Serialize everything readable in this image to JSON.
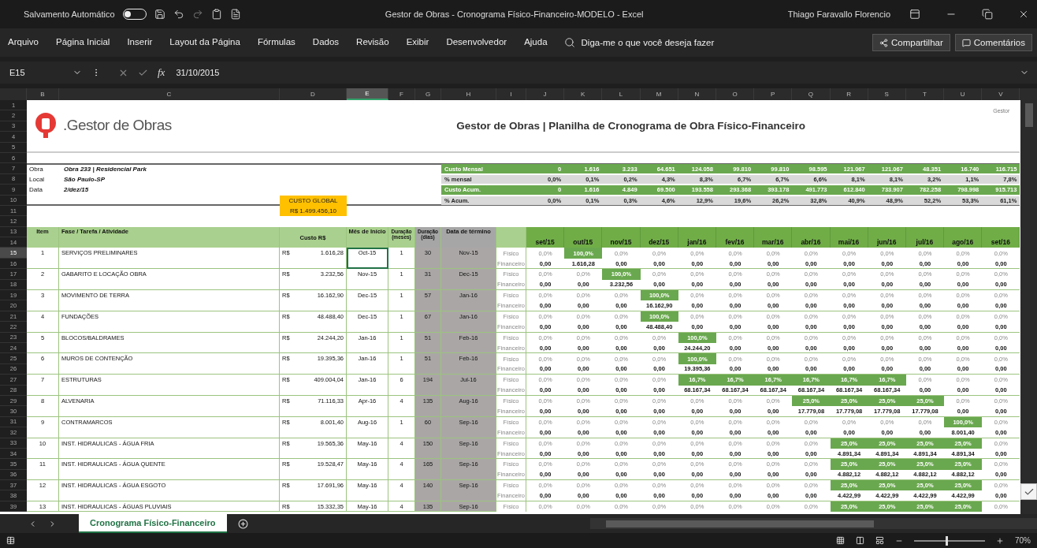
{
  "title_bar": {
    "autosave": {
      "label": "Salvamento Automático",
      "on": false
    },
    "title": "Gestor de Obras - Cronograma Físico-Financeiro-MODELO  -  Excel",
    "user": "Thiago Faravallo Florencio"
  },
  "ribbon": {
    "tabs": [
      {
        "label": "Arquivo",
        "selected": false
      },
      {
        "label": "Página Inicial",
        "selected": false
      },
      {
        "label": "Inserir",
        "selected": false
      },
      {
        "label": "Layout da Página",
        "selected": false
      },
      {
        "label": "Fórmulas",
        "selected": false
      },
      {
        "label": "Dados",
        "selected": false
      },
      {
        "label": "Revisão",
        "selected": false
      },
      {
        "label": "Exibir",
        "selected": false
      },
      {
        "label": "Desenvolvedor",
        "selected": false
      },
      {
        "label": "Ajuda",
        "selected": false
      }
    ],
    "search": {
      "placeholder": "Diga-me o que você deseja fazer"
    },
    "share": "Compartilhar",
    "comments": "Comentários"
  },
  "formula_bar": {
    "name_box": "E15",
    "function_symbol": "fx",
    "value": "31/10/2015"
  },
  "columns": [
    {
      "label": "B",
      "selected": false
    },
    {
      "label": "C",
      "selected": false
    },
    {
      "label": "D",
      "selected": false
    },
    {
      "label": "E",
      "selected": true
    },
    {
      "label": "F",
      "selected": false
    },
    {
      "label": "G",
      "selected": false
    },
    {
      "label": "H",
      "selected": false
    },
    {
      "label": "I",
      "selected": false
    },
    {
      "label": "J",
      "selected": false
    },
    {
      "label": "K",
      "selected": false
    },
    {
      "label": "L",
      "selected": false
    },
    {
      "label": "M",
      "selected": false
    },
    {
      "label": "N",
      "selected": false
    },
    {
      "label": "O",
      "selected": false
    },
    {
      "label": "P",
      "selected": false
    },
    {
      "label": "Q",
      "selected": false
    },
    {
      "label": "R",
      "selected": false
    },
    {
      "label": "S",
      "selected": false
    },
    {
      "label": "T",
      "selected": false
    },
    {
      "label": "U",
      "selected": false
    },
    {
      "label": "V",
      "selected": false
    }
  ],
  "rows": [
    {
      "label": "1",
      "selected": false
    },
    {
      "label": "2",
      "selected": false
    },
    {
      "label": "3",
      "selected": false
    },
    {
      "label": "4",
      "selected": false
    },
    {
      "label": "5",
      "selected": false
    },
    {
      "label": "6",
      "selected": false
    },
    {
      "label": "7",
      "selected": false
    },
    {
      "label": "8",
      "selected": false
    },
    {
      "label": "9",
      "selected": false
    },
    {
      "label": "10",
      "selected": false
    },
    {
      "label": "11",
      "selected": false
    },
    {
      "label": "12",
      "selected": false
    },
    {
      "label": "13",
      "selected": false
    },
    {
      "label": "14",
      "selected": false
    },
    {
      "label": "15",
      "selected": true
    },
    {
      "label": "16",
      "selected": false
    },
    {
      "label": "17",
      "selected": false
    },
    {
      "label": "18",
      "selected": false
    },
    {
      "label": "19",
      "selected": false
    },
    {
      "label": "20",
      "selected": false
    },
    {
      "label": "21",
      "selected": false
    },
    {
      "label": "22",
      "selected": false
    },
    {
      "label": "23",
      "selected": false
    },
    {
      "label": "24",
      "selected": false
    },
    {
      "label": "25",
      "selected": false
    },
    {
      "label": "26",
      "selected": false
    },
    {
      "label": "27",
      "selected": false
    },
    {
      "label": "28",
      "selected": false
    },
    {
      "label": "29",
      "selected": false
    },
    {
      "label": "30",
      "selected": false
    },
    {
      "label": "31",
      "selected": false
    },
    {
      "label": "32",
      "selected": false
    },
    {
      "label": "33",
      "selected": false
    },
    {
      "label": "34",
      "selected": false
    },
    {
      "label": "35",
      "selected": false
    },
    {
      "label": "36",
      "selected": false
    },
    {
      "label": "37",
      "selected": false
    },
    {
      "label": "38",
      "selected": false
    },
    {
      "label": "39",
      "selected": false
    }
  ],
  "sheet": {
    "brand": ".Gestor de Obras",
    "title": "Gestor de Obras | Planilha de Cronograma de Obra Físico-Financeiro",
    "corner_text": "Gestor",
    "info": [
      {
        "label": "Obra",
        "value": "Obra 233 | Residencial Park"
      },
      {
        "label": "Local",
        "value": "São Paulo-SP"
      },
      {
        "label": "Data",
        "value": "2/dez/15"
      }
    ],
    "global_cost": {
      "label": "CUSTO GLOBAL",
      "value": "R$ 1.499.456,10"
    },
    "summary": [
      {
        "label": "Custo Mensal",
        "kind": "cost",
        "values": [
          "0",
          "1.616",
          "3.233",
          "64.651",
          "124.058",
          "99.810",
          "99.810",
          "98.595",
          "121.067",
          "121.067",
          "48.351",
          "16.740",
          "116.715"
        ]
      },
      {
        "label": "% mensal",
        "kind": "percent",
        "values": [
          "0,0%",
          "0,1%",
          "0,2%",
          "4,3%",
          "8,3%",
          "6,7%",
          "6,7%",
          "6,6%",
          "8,1%",
          "8,1%",
          "3,2%",
          "1,1%",
          "7,8%"
        ]
      },
      {
        "label": "Custo Acum.",
        "kind": "cost",
        "values": [
          "0",
          "1.616",
          "4.849",
          "69.500",
          "193.558",
          "293.368",
          "393.178",
          "491.773",
          "612.840",
          "733.907",
          "782.258",
          "798.998",
          "915.713"
        ]
      },
      {
        "label": "% Acum.",
        "kind": "percent",
        "values": [
          "0,0%",
          "0,1%",
          "0,3%",
          "4,6%",
          "12,9%",
          "19,6%",
          "26,2%",
          "32,8%",
          "40,9%",
          "48,9%",
          "52,2%",
          "53,3%",
          "61,1%"
        ]
      }
    ],
    "headers": {
      "item": "Item",
      "task": "Fase / Tarefa / Atividade",
      "cost": "Custo R$",
      "start": "Mês de Início",
      "months": "Duração (meses)",
      "days": "Duração (dias)",
      "end": "Data de término"
    },
    "months": [
      "set/15",
      "out/15",
      "nov/15",
      "dez/15",
      "jan/16",
      "fev/16",
      "mar/16",
      "abr/16",
      "mai/16",
      "jun/16",
      "jul/16",
      "ago/16",
      "set/16"
    ],
    "tasks": [
      {
        "item": "1",
        "name": "SERVIÇOS PRELIMINARES",
        "currency": "R$",
        "cost": "1.616,28",
        "start": "Oct-15",
        "start_selected": true,
        "months": "1",
        "days": "30",
        "end": "Nov-15",
        "physical_label": "Físico",
        "financial_label": "Financeiro",
        "schedule": [
          {
            "pct": "0,0%",
            "value": "0,00",
            "active": false
          },
          {
            "pct": "100,0%",
            "value": "1.616,28",
            "active": true
          },
          {
            "pct": "0,0%",
            "value": "0,00",
            "active": false
          },
          {
            "pct": "0,0%",
            "value": "0,00",
            "active": false
          },
          {
            "pct": "0,0%",
            "value": "0,00",
            "active": false
          },
          {
            "pct": "0,0%",
            "value": "0,00",
            "active": false
          },
          {
            "pct": "0,0%",
            "value": "0,00",
            "active": false
          },
          {
            "pct": "0,0%",
            "value": "0,00",
            "active": false
          },
          {
            "pct": "0,0%",
            "value": "0,00",
            "active": false
          },
          {
            "pct": "0,0%",
            "value": "0,00",
            "active": false
          },
          {
            "pct": "0,0%",
            "value": "0,00",
            "active": false
          },
          {
            "pct": "0,0%",
            "value": "0,00",
            "active": false
          },
          {
            "pct": "0,0%",
            "value": "0,00",
            "active": false
          }
        ]
      },
      {
        "item": "2",
        "name": "GABARITO E LOCAÇÃO OBRA",
        "currency": "R$",
        "cost": "3.232,56",
        "start": "Nov-15",
        "start_selected": false,
        "months": "1",
        "days": "31",
        "end": "Dec-15",
        "physical_label": "Físico",
        "financial_label": "Financeiro",
        "schedule": [
          {
            "pct": "0,0%",
            "value": "0,00",
            "active": false
          },
          {
            "pct": "0,0%",
            "value": "0,00",
            "active": false
          },
          {
            "pct": "100,0%",
            "value": "3.232,56",
            "active": true
          },
          {
            "pct": "0,0%",
            "value": "0,00",
            "active": false
          },
          {
            "pct": "0,0%",
            "value": "0,00",
            "active": false
          },
          {
            "pct": "0,0%",
            "value": "0,00",
            "active": false
          },
          {
            "pct": "0,0%",
            "value": "0,00",
            "active": false
          },
          {
            "pct": "0,0%",
            "value": "0,00",
            "active": false
          },
          {
            "pct": "0,0%",
            "value": "0,00",
            "active": false
          },
          {
            "pct": "0,0%",
            "value": "0,00",
            "active": false
          },
          {
            "pct": "0,0%",
            "value": "0,00",
            "active": false
          },
          {
            "pct": "0,0%",
            "value": "0,00",
            "active": false
          },
          {
            "pct": "0,0%",
            "value": "0,00",
            "active": false
          }
        ]
      },
      {
        "item": "3",
        "name": "MOVIMENTO DE TERRA",
        "currency": "R$",
        "cost": "16.162,90",
        "start": "Dec-15",
        "start_selected": false,
        "months": "1",
        "days": "57",
        "end": "Jan-16",
        "physical_label": "Físico",
        "financial_label": "Financeiro",
        "schedule": [
          {
            "pct": "0,0%",
            "value": "0,00",
            "active": false
          },
          {
            "pct": "0,0%",
            "value": "0,00",
            "active": false
          },
          {
            "pct": "0,0%",
            "value": "0,00",
            "active": false
          },
          {
            "pct": "100,0%",
            "value": "16.162,90",
            "active": true
          },
          {
            "pct": "0,0%",
            "value": "0,00",
            "active": false
          },
          {
            "pct": "0,0%",
            "value": "0,00",
            "active": false
          },
          {
            "pct": "0,0%",
            "value": "0,00",
            "active": false
          },
          {
            "pct": "0,0%",
            "value": "0,00",
            "active": false
          },
          {
            "pct": "0,0%",
            "value": "0,00",
            "active": false
          },
          {
            "pct": "0,0%",
            "value": "0,00",
            "active": false
          },
          {
            "pct": "0,0%",
            "value": "0,00",
            "active": false
          },
          {
            "pct": "0,0%",
            "value": "0,00",
            "active": false
          },
          {
            "pct": "0,0%",
            "value": "0,00",
            "active": false
          }
        ]
      },
      {
        "item": "4",
        "name": "FUNDAÇÕES",
        "currency": "R$",
        "cost": "48.488,40",
        "start": "Dec-15",
        "start_selected": false,
        "months": "1",
        "days": "67",
        "end": "Jan-16",
        "physical_label": "Físico",
        "financial_label": "Financeiro",
        "schedule": [
          {
            "pct": "0,0%",
            "value": "0,00",
            "active": false
          },
          {
            "pct": "0,0%",
            "value": "0,00",
            "active": false
          },
          {
            "pct": "0,0%",
            "value": "0,00",
            "active": false
          },
          {
            "pct": "100,0%",
            "value": "48.488,40",
            "active": true
          },
          {
            "pct": "0,0%",
            "value": "0,00",
            "active": false
          },
          {
            "pct": "0,0%",
            "value": "0,00",
            "active": false
          },
          {
            "pct": "0,0%",
            "value": "0,00",
            "active": false
          },
          {
            "pct": "0,0%",
            "value": "0,00",
            "active": false
          },
          {
            "pct": "0,0%",
            "value": "0,00",
            "active": false
          },
          {
            "pct": "0,0%",
            "value": "0,00",
            "active": false
          },
          {
            "pct": "0,0%",
            "value": "0,00",
            "active": false
          },
          {
            "pct": "0,0%",
            "value": "0,00",
            "active": false
          },
          {
            "pct": "0,0%",
            "value": "0,00",
            "active": false
          }
        ]
      },
      {
        "item": "5",
        "name": "BLOCOS/BALDRAMES",
        "currency": "R$",
        "cost": "24.244,20",
        "start": "Jan-16",
        "start_selected": false,
        "months": "1",
        "days": "51",
        "end": "Feb-16",
        "physical_label": "Físico",
        "financial_label": "Financeiro",
        "schedule": [
          {
            "pct": "0,0%",
            "value": "0,00",
            "active": false
          },
          {
            "pct": "0,0%",
            "value": "0,00",
            "active": false
          },
          {
            "pct": "0,0%",
            "value": "0,00",
            "active": false
          },
          {
            "pct": "0,0%",
            "value": "0,00",
            "active": false
          },
          {
            "pct": "100,0%",
            "value": "24.244,20",
            "active": true
          },
          {
            "pct": "0,0%",
            "value": "0,00",
            "active": false
          },
          {
            "pct": "0,0%",
            "value": "0,00",
            "active": false
          },
          {
            "pct": "0,0%",
            "value": "0,00",
            "active": false
          },
          {
            "pct": "0,0%",
            "value": "0,00",
            "active": false
          },
          {
            "pct": "0,0%",
            "value": "0,00",
            "active": false
          },
          {
            "pct": "0,0%",
            "value": "0,00",
            "active": false
          },
          {
            "pct": "0,0%",
            "value": "0,00",
            "active": false
          },
          {
            "pct": "0,0%",
            "value": "0,00",
            "active": false
          }
        ]
      },
      {
        "item": "6",
        "name": "MUROS DE CONTENÇÃO",
        "currency": "R$",
        "cost": "19.395,36",
        "start": "Jan-16",
        "start_selected": false,
        "months": "1",
        "days": "51",
        "end": "Feb-16",
        "physical_label": "Físico",
        "financial_label": "Financeiro",
        "schedule": [
          {
            "pct": "0,0%",
            "value": "0,00",
            "active": false
          },
          {
            "pct": "0,0%",
            "value": "0,00",
            "active": false
          },
          {
            "pct": "0,0%",
            "value": "0,00",
            "active": false
          },
          {
            "pct": "0,0%",
            "value": "0,00",
            "active": false
          },
          {
            "pct": "100,0%",
            "value": "19.395,36",
            "active": true
          },
          {
            "pct": "0,0%",
            "value": "0,00",
            "active": false
          },
          {
            "pct": "0,0%",
            "value": "0,00",
            "active": false
          },
          {
            "pct": "0,0%",
            "value": "0,00",
            "active": false
          },
          {
            "pct": "0,0%",
            "value": "0,00",
            "active": false
          },
          {
            "pct": "0,0%",
            "value": "0,00",
            "active": false
          },
          {
            "pct": "0,0%",
            "value": "0,00",
            "active": false
          },
          {
            "pct": "0,0%",
            "value": "0,00",
            "active": false
          },
          {
            "pct": "0,0%",
            "value": "0,00",
            "active": false
          }
        ]
      },
      {
        "item": "7",
        "name": "ESTRUTURAS",
        "currency": "R$",
        "cost": "409.004,04",
        "start": "Jan-16",
        "start_selected": false,
        "months": "6",
        "days": "194",
        "end": "Jul-16",
        "physical_label": "Físico",
        "financial_label": "Financeiro",
        "schedule": [
          {
            "pct": "0,0%",
            "value": "0,00",
            "active": false
          },
          {
            "pct": "0,0%",
            "value": "0,00",
            "active": false
          },
          {
            "pct": "0,0%",
            "value": "0,00",
            "active": false
          },
          {
            "pct": "0,0%",
            "value": "0,00",
            "active": false
          },
          {
            "pct": "16,7%",
            "value": "68.167,34",
            "active": true
          },
          {
            "pct": "16,7%",
            "value": "68.167,34",
            "active": true
          },
          {
            "pct": "16,7%",
            "value": "68.167,34",
            "active": true
          },
          {
            "pct": "16,7%",
            "value": "68.167,34",
            "active": true
          },
          {
            "pct": "16,7%",
            "value": "68.167,34",
            "active": true
          },
          {
            "pct": "16,7%",
            "value": "68.167,34",
            "active": true
          },
          {
            "pct": "0,0%",
            "value": "0,00",
            "active": false
          },
          {
            "pct": "0,0%",
            "value": "0,00",
            "active": false
          },
          {
            "pct": "0,0%",
            "value": "0,00",
            "active": false
          }
        ]
      },
      {
        "item": "8",
        "name": "ALVENARIA",
        "currency": "R$",
        "cost": "71.116,33",
        "start": "Apr-16",
        "start_selected": false,
        "months": "4",
        "days": "135",
        "end": "Aug-16",
        "physical_label": "Físico",
        "financial_label": "Financeiro",
        "schedule": [
          {
            "pct": "0,0%",
            "value": "0,00",
            "active": false
          },
          {
            "pct": "0,0%",
            "value": "0,00",
            "active": false
          },
          {
            "pct": "0,0%",
            "value": "0,00",
            "active": false
          },
          {
            "pct": "0,0%",
            "value": "0,00",
            "active": false
          },
          {
            "pct": "0,0%",
            "value": "0,00",
            "active": false
          },
          {
            "pct": "0,0%",
            "value": "0,00",
            "active": false
          },
          {
            "pct": "0,0%",
            "value": "0,00",
            "active": false
          },
          {
            "pct": "25,0%",
            "value": "17.779,08",
            "active": true
          },
          {
            "pct": "25,0%",
            "value": "17.779,08",
            "active": true
          },
          {
            "pct": "25,0%",
            "value": "17.779,08",
            "active": true
          },
          {
            "pct": "25,0%",
            "value": "17.779,08",
            "active": true
          },
          {
            "pct": "0,0%",
            "value": "0,00",
            "active": false
          },
          {
            "pct": "0,0%",
            "value": "0,00",
            "active": false
          }
        ]
      },
      {
        "item": "9",
        "name": "CONTRAMARCOS",
        "currency": "R$",
        "cost": "8.001,40",
        "start": "Aug-16",
        "start_selected": false,
        "months": "1",
        "days": "60",
        "end": "Sep-16",
        "physical_label": "Físico",
        "financial_label": "Financeiro",
        "schedule": [
          {
            "pct": "0,0%",
            "value": "0,00",
            "active": false
          },
          {
            "pct": "0,0%",
            "value": "0,00",
            "active": false
          },
          {
            "pct": "0,0%",
            "value": "0,00",
            "active": false
          },
          {
            "pct": "0,0%",
            "value": "0,00",
            "active": false
          },
          {
            "pct": "0,0%",
            "value": "0,00",
            "active": false
          },
          {
            "pct": "0,0%",
            "value": "0,00",
            "active": false
          },
          {
            "pct": "0,0%",
            "value": "0,00",
            "active": false
          },
          {
            "pct": "0,0%",
            "value": "0,00",
            "active": false
          },
          {
            "pct": "0,0%",
            "value": "0,00",
            "active": false
          },
          {
            "pct": "0,0%",
            "value": "0,00",
            "active": false
          },
          {
            "pct": "0,0%",
            "value": "0,00",
            "active": false
          },
          {
            "pct": "100,0%",
            "value": "8.001,40",
            "active": true
          },
          {
            "pct": "0,0%",
            "value": "0,00",
            "active": false
          }
        ]
      },
      {
        "item": "10",
        "name": "INST. HIDRAULICAS - ÁGUA FRIA",
        "currency": "R$",
        "cost": "19.565,36",
        "start": "May-16",
        "start_selected": false,
        "months": "4",
        "days": "150",
        "end": "Sep-16",
        "physical_label": "Físico",
        "financial_label": "Financeiro",
        "schedule": [
          {
            "pct": "0,0%",
            "value": "0,00",
            "active": false
          },
          {
            "pct": "0,0%",
            "value": "0,00",
            "active": false
          },
          {
            "pct": "0,0%",
            "value": "0,00",
            "active": false
          },
          {
            "pct": "0,0%",
            "value": "0,00",
            "active": false
          },
          {
            "pct": "0,0%",
            "value": "0,00",
            "active": false
          },
          {
            "pct": "0,0%",
            "value": "0,00",
            "active": false
          },
          {
            "pct": "0,0%",
            "value": "0,00",
            "active": false
          },
          {
            "pct": "0,0%",
            "value": "0,00",
            "active": false
          },
          {
            "pct": "25,0%",
            "value": "4.891,34",
            "active": true
          },
          {
            "pct": "25,0%",
            "value": "4.891,34",
            "active": true
          },
          {
            "pct": "25,0%",
            "value": "4.891,34",
            "active": true
          },
          {
            "pct": "25,0%",
            "value": "4.891,34",
            "active": true
          },
          {
            "pct": "0,0%",
            "value": "0,00",
            "active": false
          }
        ]
      },
      {
        "item": "11",
        "name": "INST. HIDRAULICAS - ÁGUA QUENTE",
        "currency": "R$",
        "cost": "19.528,47",
        "start": "May-16",
        "start_selected": false,
        "months": "4",
        "days": "165",
        "end": "Sep-16",
        "physical_label": "Físico",
        "financial_label": "Financeiro",
        "schedule": [
          {
            "pct": "0,0%",
            "value": "0,00",
            "active": false
          },
          {
            "pct": "0,0%",
            "value": "0,00",
            "active": false
          },
          {
            "pct": "0,0%",
            "value": "0,00",
            "active": false
          },
          {
            "pct": "0,0%",
            "value": "0,00",
            "active": false
          },
          {
            "pct": "0,0%",
            "value": "0,00",
            "active": false
          },
          {
            "pct": "0,0%",
            "value": "0,00",
            "active": false
          },
          {
            "pct": "0,0%",
            "value": "0,00",
            "active": false
          },
          {
            "pct": "0,0%",
            "value": "0,00",
            "active": false
          },
          {
            "pct": "25,0%",
            "value": "4.882,12",
            "active": true
          },
          {
            "pct": "25,0%",
            "value": "4.882,12",
            "active": true
          },
          {
            "pct": "25,0%",
            "value": "4.882,12",
            "active": true
          },
          {
            "pct": "25,0%",
            "value": "4.882,12",
            "active": true
          },
          {
            "pct": "0,0%",
            "value": "0,00",
            "active": false
          }
        ]
      },
      {
        "item": "12",
        "name": "INST. HIDRAULICAS - ÁGUA ESGOTO",
        "currency": "R$",
        "cost": "17.691,96",
        "start": "May-16",
        "start_selected": false,
        "months": "4",
        "days": "140",
        "end": "Sep-16",
        "physical_label": "Físico",
        "financial_label": "Financeiro",
        "schedule": [
          {
            "pct": "0,0%",
            "value": "0,00",
            "active": false
          },
          {
            "pct": "0,0%",
            "value": "0,00",
            "active": false
          },
          {
            "pct": "0,0%",
            "value": "0,00",
            "active": false
          },
          {
            "pct": "0,0%",
            "value": "0,00",
            "active": false
          },
          {
            "pct": "0,0%",
            "value": "0,00",
            "active": false
          },
          {
            "pct": "0,0%",
            "value": "0,00",
            "active": false
          },
          {
            "pct": "0,0%",
            "value": "0,00",
            "active": false
          },
          {
            "pct": "0,0%",
            "value": "0,00",
            "active": false
          },
          {
            "pct": "25,0%",
            "value": "4.422,99",
            "active": true
          },
          {
            "pct": "25,0%",
            "value": "4.422,99",
            "active": true
          },
          {
            "pct": "25,0%",
            "value": "4.422,99",
            "active": true
          },
          {
            "pct": "25,0%",
            "value": "4.422,99",
            "active": true
          },
          {
            "pct": "0,0%",
            "value": "0,00",
            "active": false
          }
        ]
      },
      {
        "item": "13",
        "name": "INST. HIDRAULICAS - ÁGUAS PLUVIAIS",
        "currency": "R$",
        "cost": "15.332,35",
        "start": "May-16",
        "start_selected": false,
        "months": "4",
        "days": "135",
        "end": "Sep-16",
        "physical_label": "Físico",
        "schedule": [
          {
            "pct": "0,0%",
            "active": false
          },
          {
            "pct": "0,0%",
            "active": false
          },
          {
            "pct": "0,0%",
            "active": false
          },
          {
            "pct": "0,0%",
            "active": false
          },
          {
            "pct": "0,0%",
            "active": false
          },
          {
            "pct": "0,0%",
            "active": false
          },
          {
            "pct": "0,0%",
            "active": false
          },
          {
            "pct": "0,0%",
            "active": false
          },
          {
            "pct": "25,0%",
            "active": true
          },
          {
            "pct": "25,0%",
            "active": true
          },
          {
            "pct": "25,0%",
            "active": true
          },
          {
            "pct": "25,0%",
            "active": true
          },
          {
            "pct": "0,0%",
            "active": false
          }
        ]
      }
    ]
  },
  "sheet_tabs": [
    {
      "label": "Cronograma Físico-Financeiro",
      "selected": true
    }
  ],
  "status_bar": {
    "zoom": {
      "level": 0.45,
      "label": "70%"
    }
  }
}
